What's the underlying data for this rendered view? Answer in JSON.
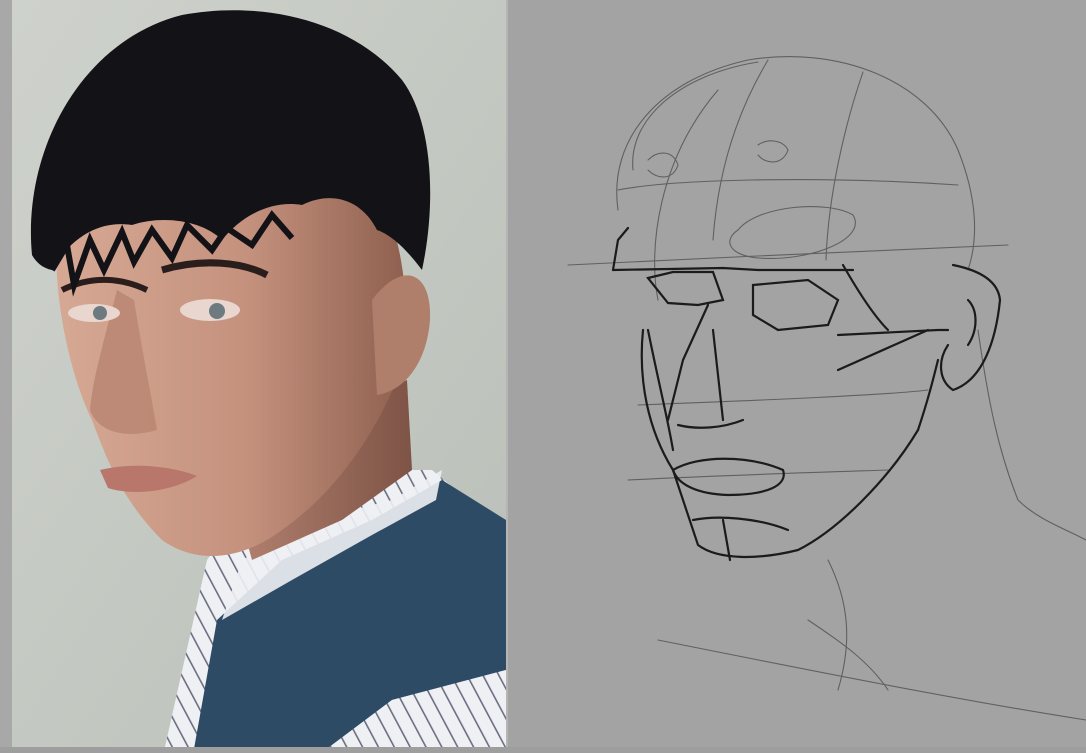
{
  "reference_photo": {
    "subject": "portrait",
    "colors": {
      "backdrop": "#c9cdc6",
      "hair": "#121217",
      "skin": "#c99a86",
      "skin_shadow": "#9c6c5a",
      "sweater": "#2e4b66",
      "shirt": "#eef0f4",
      "shirt_stripe": "#6b6f80"
    }
  },
  "sketch": {
    "colors": {
      "canvas": "#a3a3a3",
      "line_dark": "#1b1b1b",
      "line_light": "#555555"
    }
  }
}
